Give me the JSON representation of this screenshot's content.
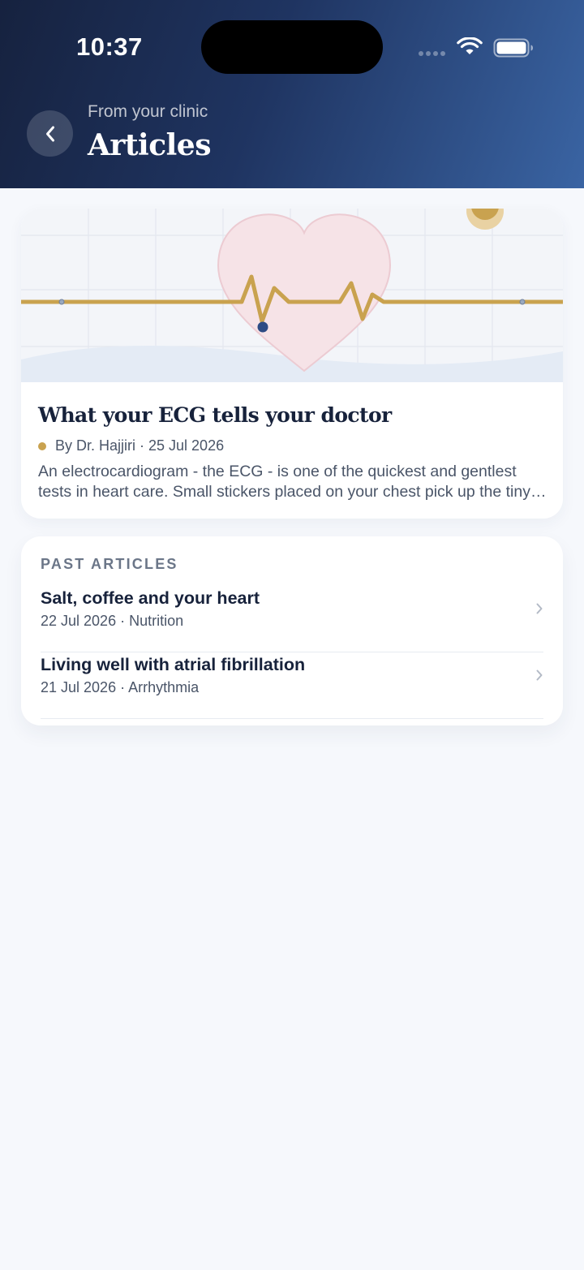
{
  "status_bar": {
    "time": "10:37"
  },
  "header": {
    "subtitle": "From your clinic",
    "title": "Articles"
  },
  "featured": {
    "title": "What your ECG tells your doctor",
    "author": "By Dr. Hajjiri",
    "date": "25 Jul 2026",
    "excerpt": "An electrocardiogram - the ECG - is one of the quickest and gentlest tests in heart care. Small stickers placed on your chest pick up the tiny electrical signals of your heartbeat."
  },
  "past_articles": {
    "heading": "PAST ARTICLES",
    "items": [
      {
        "title": "Salt, coffee and your heart",
        "date": "22 Jul 2026",
        "category": "Nutrition"
      },
      {
        "title": "Living well with atrial fibrillation",
        "date": "21 Jul 2026",
        "category": "Arrhythmia"
      }
    ]
  },
  "colors": {
    "header_start": "#16223f",
    "header_end": "#3a64a3",
    "accent_gold": "#c9a24f",
    "heart_fill": "#f6e3e7",
    "text_dark": "#17223b",
    "background": "#f6f8fc"
  },
  "icons": [
    "back-chevron-icon",
    "wifi-icon",
    "battery-icon",
    "chevron-right-icon",
    "heart-illustration"
  ]
}
